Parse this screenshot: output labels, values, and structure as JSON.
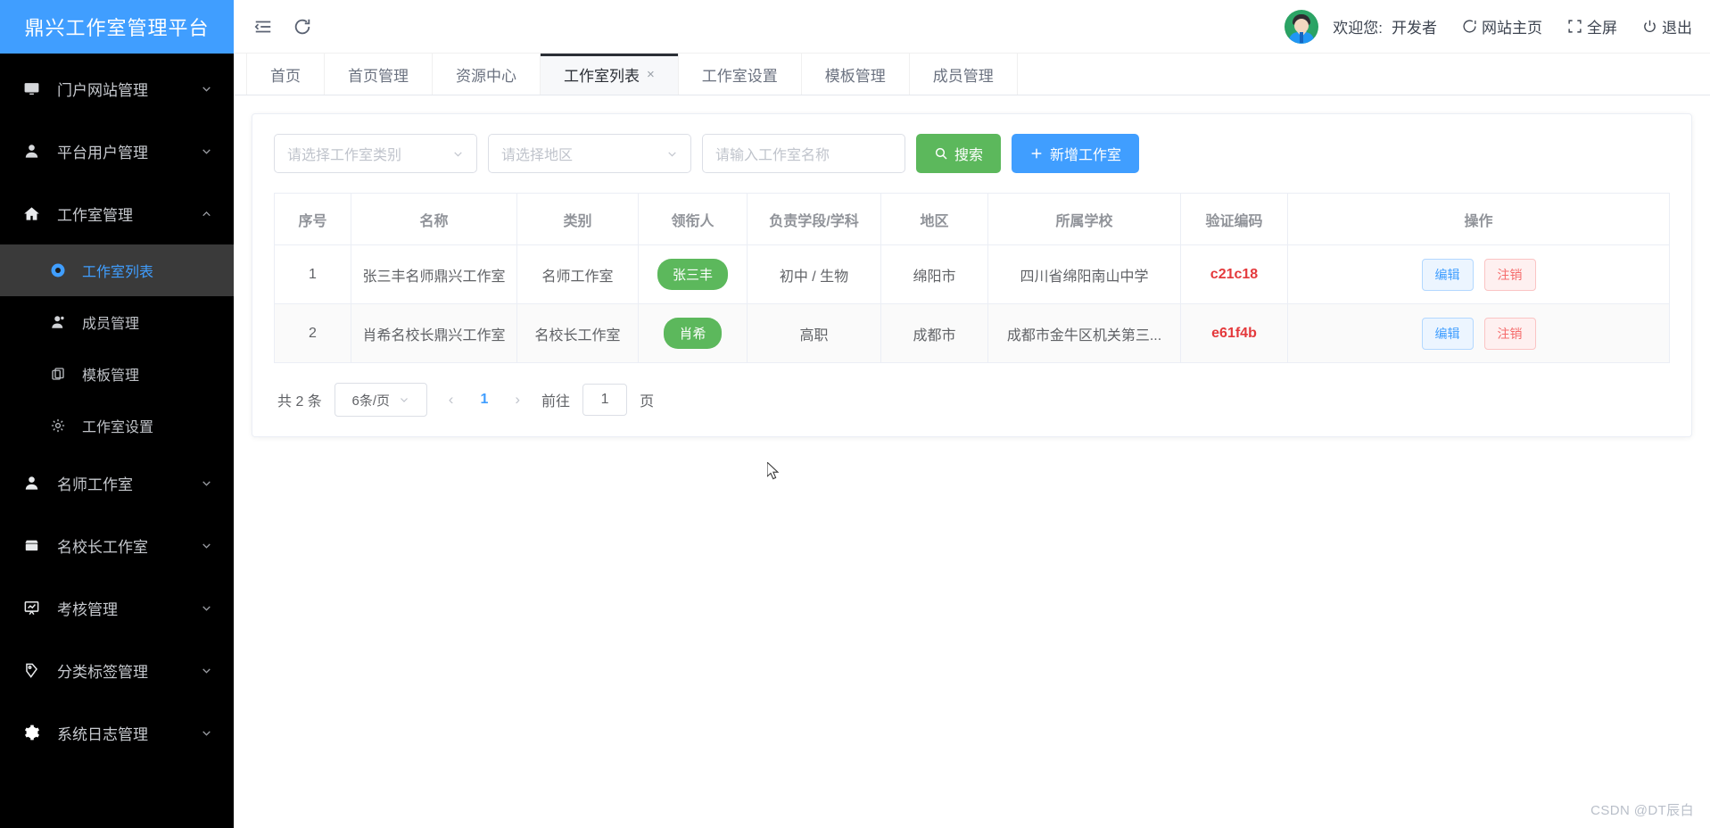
{
  "brand": {
    "title": "鼎兴工作室管理平台"
  },
  "topbar": {
    "collapse_icon": "menu-collapse-icon",
    "refresh_icon": "refresh-icon",
    "welcome_label": "欢迎您:",
    "user_name": "开发者",
    "site_home_label": "网站主页",
    "fullscreen_label": "全屏",
    "logout_label": "退出"
  },
  "sidebar": {
    "items": [
      {
        "label": "门户网站管理",
        "icon": "monitor-icon",
        "arrow": "chevron-down",
        "expanded": false
      },
      {
        "label": "平台用户管理",
        "icon": "user-icon",
        "arrow": "chevron-down",
        "expanded": false
      },
      {
        "label": "工作室管理",
        "icon": "home-icon",
        "arrow": "chevron-up",
        "expanded": true
      },
      {
        "label": "名师工作室",
        "icon": "user-solid-icon",
        "arrow": "chevron-down",
        "expanded": false
      },
      {
        "label": "名校长工作室",
        "icon": "shop-icon",
        "arrow": "chevron-down",
        "expanded": false
      },
      {
        "label": "考核管理",
        "icon": "data-board-icon",
        "arrow": "chevron-down",
        "expanded": false
      },
      {
        "label": "分类标签管理",
        "icon": "tag-icon",
        "arrow": "chevron-down",
        "expanded": false
      },
      {
        "label": "系统日志管理",
        "icon": "setting-gear-icon",
        "arrow": "chevron-down",
        "expanded": false
      }
    ],
    "submenu": [
      {
        "label": "工作室列表",
        "icon": "partner-icon",
        "active": true
      },
      {
        "label": "成员管理",
        "icon": "member-icon",
        "active": false
      },
      {
        "label": "模板管理",
        "icon": "copy-icon",
        "active": false
      },
      {
        "label": "工作室设置",
        "icon": "gear-icon",
        "active": false
      }
    ]
  },
  "tabs": [
    {
      "label": "首页",
      "closable": false,
      "active": false
    },
    {
      "label": "首页管理",
      "closable": false,
      "active": false
    },
    {
      "label": "资源中心",
      "closable": false,
      "active": false
    },
    {
      "label": "工作室列表",
      "closable": true,
      "close_glyph": "×",
      "active": true
    },
    {
      "label": "工作室设置",
      "closable": false,
      "active": false
    },
    {
      "label": "模板管理",
      "closable": false,
      "active": false
    },
    {
      "label": "成员管理",
      "closable": false,
      "active": false
    }
  ],
  "filters": {
    "category_placeholder": "请选择工作室类别",
    "region_placeholder": "请选择地区",
    "name_placeholder": "请输入工作室名称",
    "search_label": "搜索",
    "search_icon": "search-icon",
    "add_label": "新增工作室",
    "add_icon": "plus-icon"
  },
  "table": {
    "columns": [
      "序号",
      "名称",
      "类别",
      "领衔人",
      "负责学段/学科",
      "地区",
      "所属学校",
      "验证编码",
      "操作"
    ],
    "rows": [
      {
        "index": "1",
        "name": "张三丰名师鼎兴工作室",
        "category": "名师工作室",
        "leader": "张三丰",
        "stage_subject": "初中 / 生物",
        "region": "绵阳市",
        "school": "四川省绵阳南山中学",
        "code": "c21c18",
        "edit_label": "编辑",
        "cancel_label": "注销"
      },
      {
        "index": "2",
        "name": "肖希名校长鼎兴工作室",
        "category": "名校长工作室",
        "leader": "肖希",
        "stage_subject": "高职",
        "region": "成都市",
        "school": "成都市金牛区机关第三...",
        "code": "e61f4b",
        "edit_label": "编辑",
        "cancel_label": "注销"
      }
    ]
  },
  "pagination": {
    "total_label": "共 2 条",
    "page_size_label": "6条/页",
    "prev_glyph": "‹",
    "next_glyph": "›",
    "current_page": "1",
    "jump_label": "前往",
    "jump_value": "1",
    "page_unit": "页"
  },
  "watermark": {
    "text": "CSDN @DT辰白"
  },
  "colors": {
    "brand_blue": "#409eff",
    "sidebar_black": "#000000",
    "sidebar_active": "#3a3a3a",
    "search_green": "#5cb85c",
    "code_red": "#e4393c"
  }
}
